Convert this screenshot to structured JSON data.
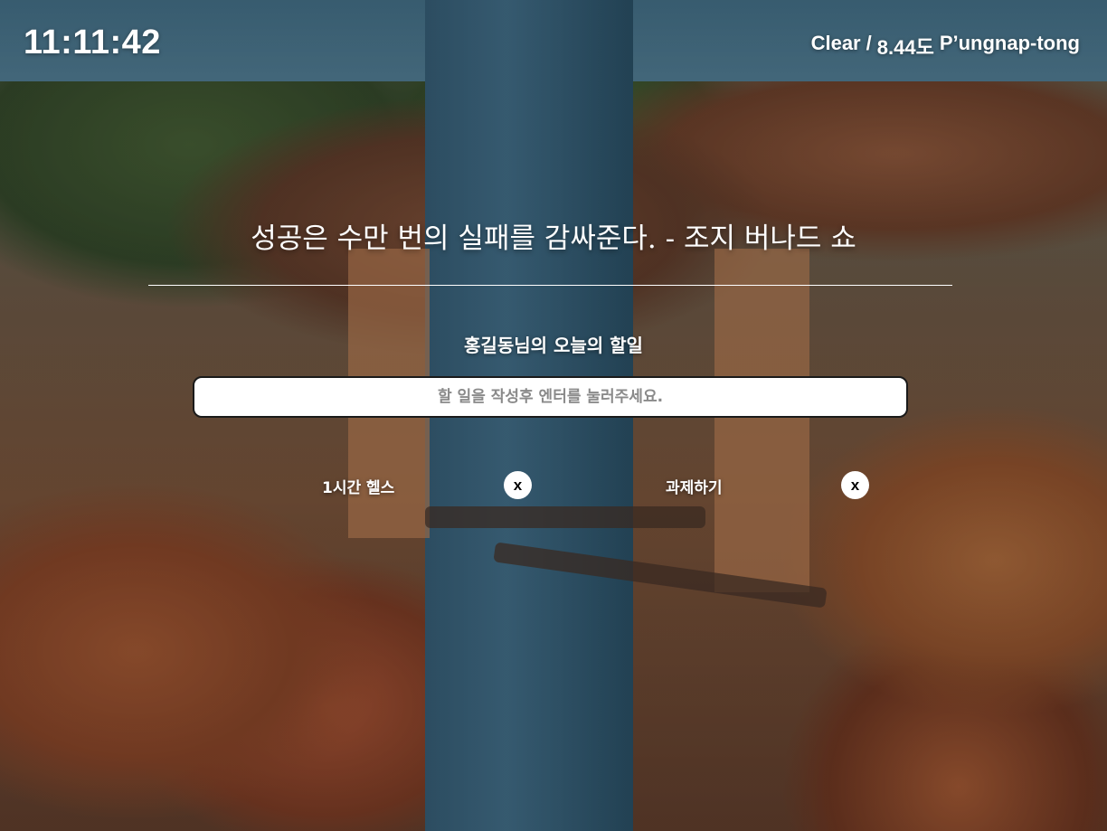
{
  "clock": {
    "time": "11:11:42"
  },
  "weather": {
    "condition": "Clear",
    "separator": "/",
    "temperature": "8.44도",
    "location": "P’ungnap-tong"
  },
  "quote": {
    "text": "성공은 수만 번의 실패를 감싸준다. - 조지 버나드 쇼"
  },
  "greeting": {
    "text": "홍길동님의 오늘의 할일"
  },
  "todo_input": {
    "placeholder": "할 일을 작성후 엔터를 눌러주세요.",
    "value": ""
  },
  "todos": [
    {
      "label": "1시간 헬스",
      "delete_label": "x"
    },
    {
      "label": "과제하기",
      "delete_label": "x"
    }
  ]
}
